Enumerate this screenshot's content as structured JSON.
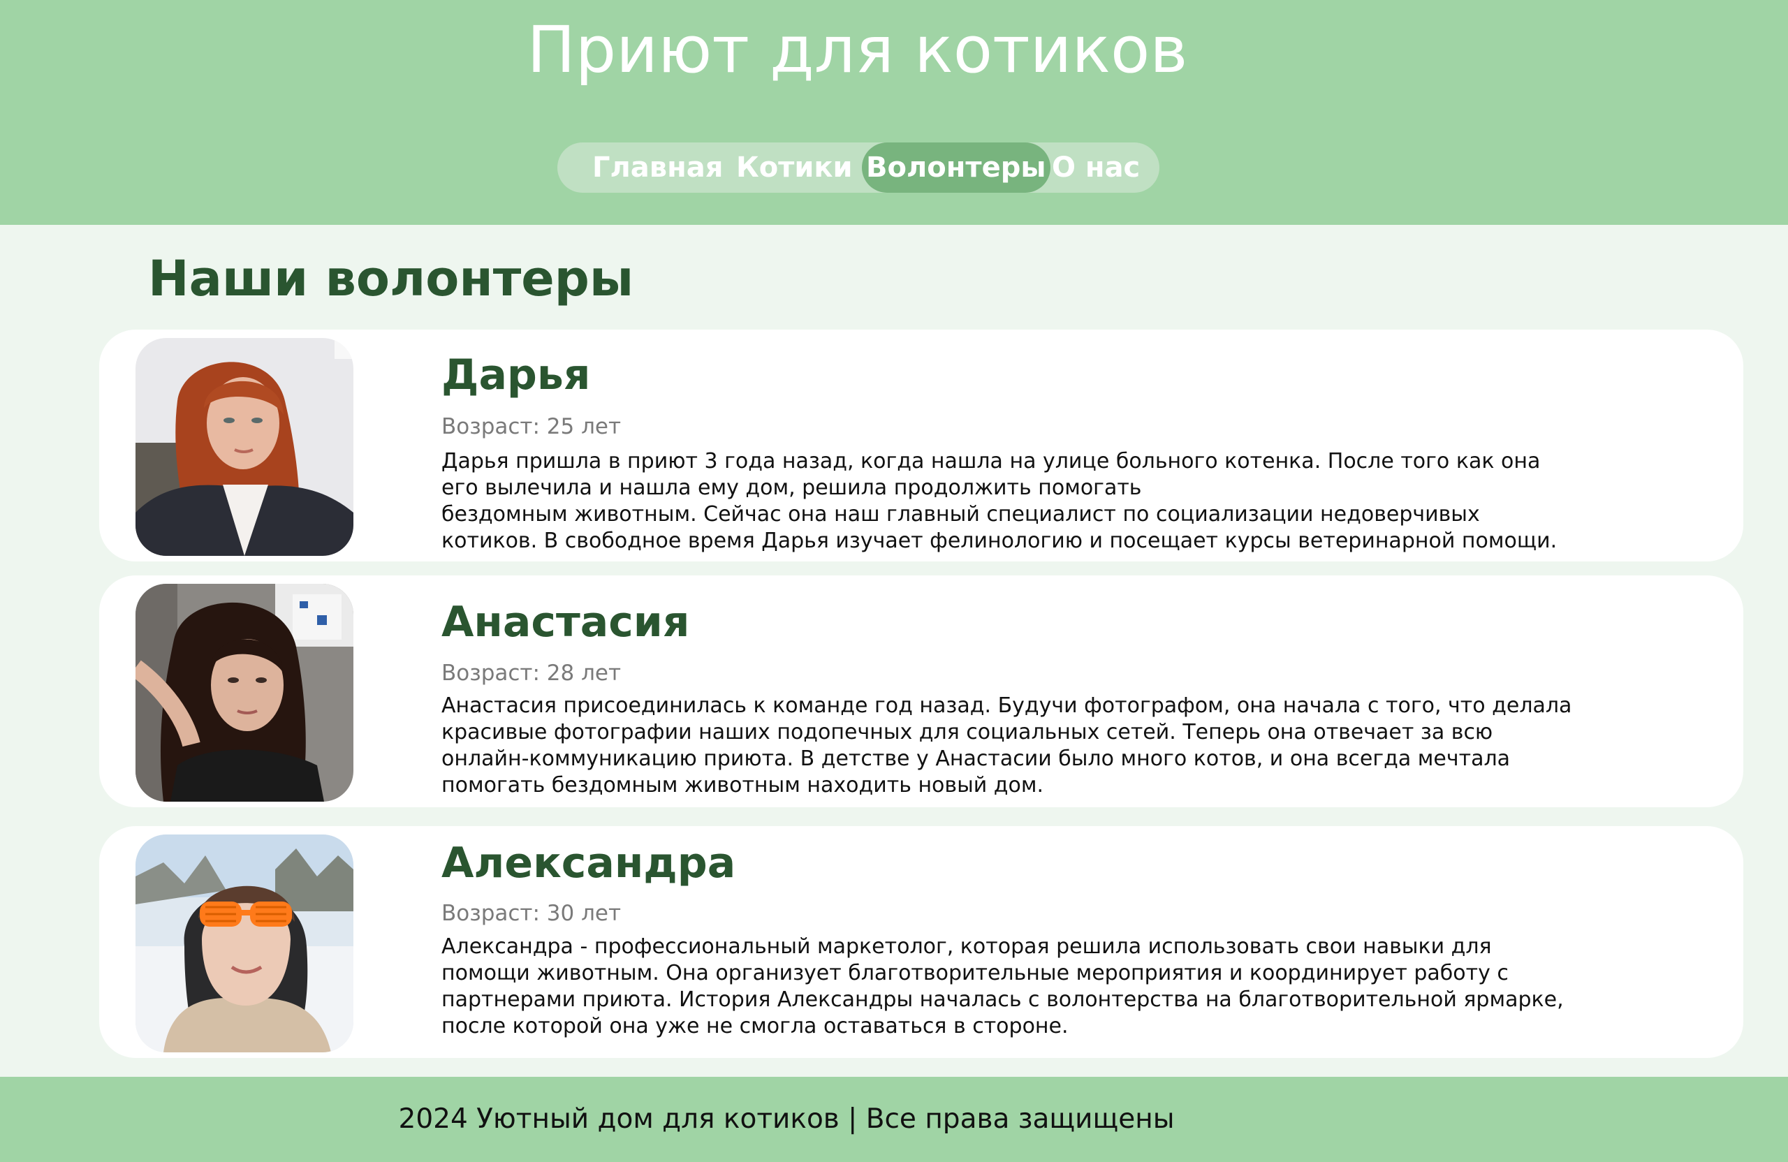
{
  "header": {
    "title": "Приют для котиков"
  },
  "nav": {
    "items": [
      {
        "label": "Главная"
      },
      {
        "label": "Котики"
      },
      {
        "label": "Волонтеры"
      },
      {
        "label": "О нас"
      }
    ],
    "active": "Волонтеры"
  },
  "main": {
    "title": "Наши волонтеры",
    "volunteers": [
      {
        "name": "Дарья",
        "age": "Возраст: 25 лет",
        "bio": [
          "Дарья пришла в приют 3 года назад, когда нашла на улице больного котенка. После того как она",
          "его вылечила и нашла ему дом, решила продолжить помогать",
          "бездомным животным. Сейчас она наш главный специалист по социализации недоверчивых",
          "котиков. В свободное время Дарья изучает фелинологию и посещает курсы ветеринарной помощи."
        ],
        "photo": "portrait-photo"
      },
      {
        "name": "Анастасия",
        "age": "Возраст: 28 лет",
        "bio": [
          "Анастасия присоединилась к команде год назад. Будучи фотографом, она начала с того, что делала",
          "красивые фотографии наших подопечных для социальных сетей. Теперь она отвечает за всю",
          "онлайн-коммуникацию приюта. В детстве у Анастасии было много котов, и она всегда мечтала",
          "помогать бездомным животным находить новый дом."
        ],
        "photo": "portrait-photo"
      },
      {
        "name": "Александра",
        "age": "Возраст: 30 лет",
        "bio": [
          "Александра - профессиональный маркетолог, которая решила использовать свои навыки для",
          "помощи животным. Она организует благотворительные мероприятия и координирует работу с",
          "партнерами приюта. История Александры началась с волонтерства на благотворительной ярмарке,",
          "после которой она уже не смогла оставаться в стороне."
        ],
        "photo": "portrait-photo"
      }
    ]
  },
  "footer": {
    "text": "2024 Уютный дом для котиков | Все права защищены"
  },
  "colors": {
    "header_bg": "#a0d4a5",
    "page_bg": "#eef6ef",
    "accent_dark_green": "#2a5530",
    "nav_pill_bg": "#c0e0c3",
    "nav_active_bg": "#78b47e"
  }
}
